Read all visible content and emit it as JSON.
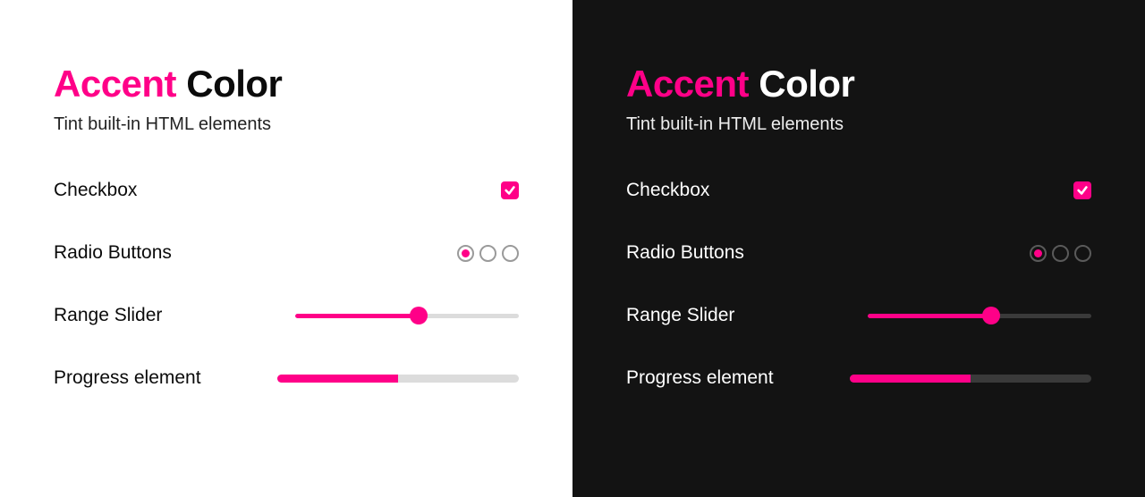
{
  "accent_color": "#ff0088",
  "title": {
    "accent_word": "Accent",
    "color_word": "Color"
  },
  "subtitle": "Tint built-in HTML elements",
  "rows": {
    "checkbox": {
      "label": "Checkbox",
      "checked": true
    },
    "radio": {
      "label": "Radio Buttons",
      "options": [
        true,
        false,
        false
      ]
    },
    "range": {
      "label": "Range Slider",
      "value": 55,
      "min": 0,
      "max": 100
    },
    "progress": {
      "label": "Progress element",
      "value": 50,
      "max": 100
    }
  }
}
